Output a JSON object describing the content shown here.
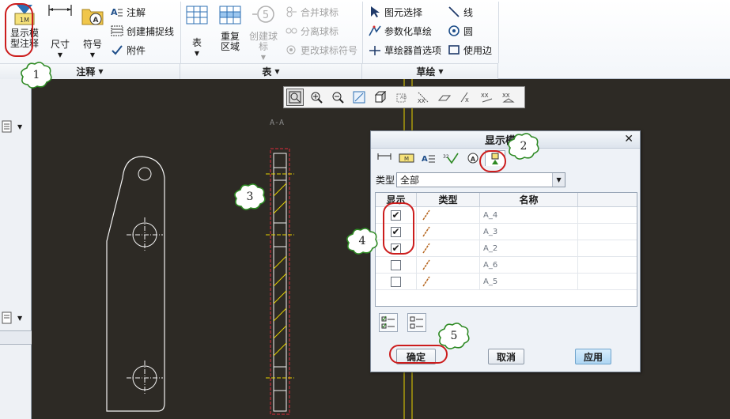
{
  "ribbon": {
    "groups": [
      {
        "label": "注释"
      },
      {
        "label": "表"
      },
      {
        "label": "草绘"
      }
    ],
    "display_model": {
      "line1": "显示模",
      "line2": "型注释"
    },
    "dimension": "尺寸",
    "symbol": "符号",
    "annotation": "注解",
    "create_snap_line": "创建捕捉线",
    "attachment": "附件",
    "table": "表",
    "repeat_region": {
      "line1": "重复",
      "line2": "区域"
    },
    "create_balloon": {
      "line1": "创建球",
      "line2": "标"
    },
    "merge_balloon": "合并球标",
    "split_balloon": "分离球标",
    "change_balloon_symbol": "更改球标符号",
    "select_elements": "图元选择",
    "parametric_sketch": "参数化草绘",
    "sketcher_prefs": "草绘器首选项",
    "line": "线",
    "circle": "圆",
    "use_edge": "使用边",
    "balloon_number": "5"
  },
  "canvas": {
    "view_label": "A-A"
  },
  "dialog": {
    "title": "显示模型",
    "close": "✕",
    "tabs": [
      "dimension-tab",
      "geometric-tolerance-tab",
      "note-tab",
      "surface-finish-tab",
      "symbol-tab",
      "datum-tab"
    ],
    "filter_label": "类型",
    "filter_value": "全部",
    "columns": {
      "show": "显示",
      "type": "类型",
      "name": "名称"
    },
    "rows": [
      {
        "checked": true,
        "name": "A_4"
      },
      {
        "checked": true,
        "name": "A_3"
      },
      {
        "checked": true,
        "name": "A_2"
      },
      {
        "checked": false,
        "name": "A_6"
      },
      {
        "checked": false,
        "name": "A_5"
      }
    ],
    "ok": "确定",
    "cancel": "取消",
    "apply": "应用"
  },
  "callouts": [
    "1",
    "2",
    "3",
    "4",
    "5"
  ],
  "colors": {
    "ring": "#cc1d1d",
    "canvas": "#2d2a25",
    "callout_fill": "#ffffff",
    "callout_stroke": "#2e8a24"
  }
}
